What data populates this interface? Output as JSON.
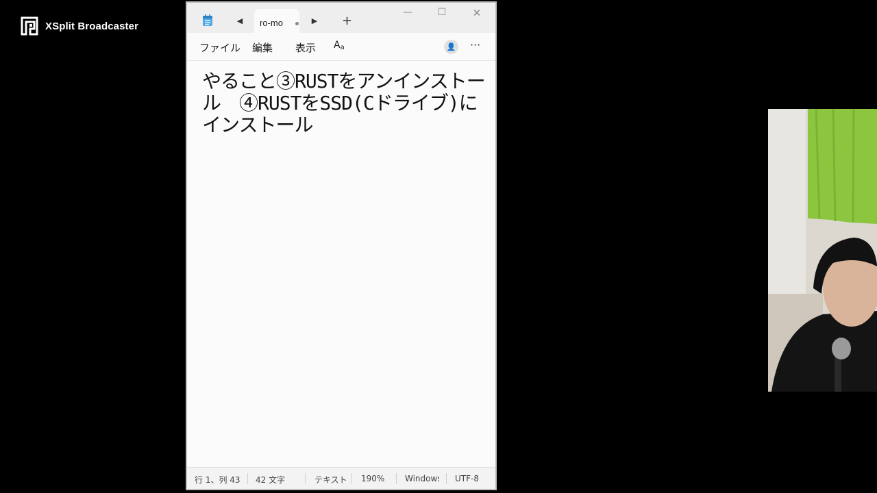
{
  "watermark": {
    "brand": "XSplit Broadcaster"
  },
  "notepad": {
    "tab_title": "ro-mo",
    "new_tab_symbol": "+",
    "prev_symbol": "◀",
    "next_symbol": "▶",
    "window_controls": {
      "minimize": "—",
      "maximize": "☐",
      "close": "✕"
    },
    "menu": {
      "file": "ファイル",
      "edit": "編集",
      "view": "表示",
      "font": "A"
    },
    "more_symbol": "···",
    "content": "やること③RUSTをアンインストール　④RUSTをSSD(Cドライブ)にインストール",
    "status": {
      "position": "行 1、列 43",
      "char_count": "42 文字",
      "format": "テキスト",
      "zoom": "190%",
      "line_ending": "Windows",
      "encoding": "UTF-8"
    }
  },
  "colors": {
    "window_bg": "#f7f7f7",
    "titlebar_bg": "#eeeeee",
    "page_bg": "#000000",
    "curtain": "#8cc63f"
  },
  "icons": [
    "xsplit-logo-icon",
    "notepad-app-icon",
    "account-icon",
    "more-icon"
  ]
}
